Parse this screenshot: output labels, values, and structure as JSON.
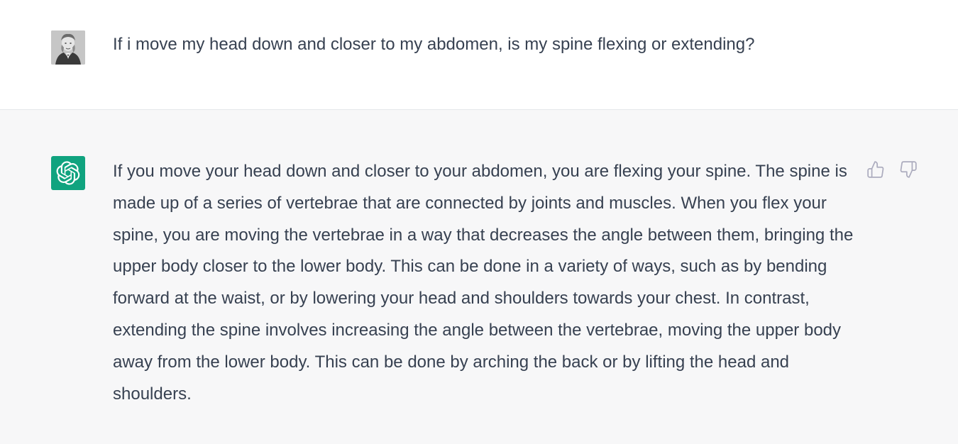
{
  "conversation": {
    "user_message": {
      "avatar_icon": "user-portrait-avatar",
      "text": "If i move my head down and closer to my abdomen, is my spine flexing or extending?"
    },
    "assistant_message": {
      "avatar_icon": "openai-logo-icon",
      "avatar_color": "#10a37f",
      "text": "If you move your head down and closer to your abdomen, you are flexing your spine. The spine is made up of a series of vertebrae that are connected by joints and muscles. When you flex your spine, you are moving the vertebrae in a way that decreases the angle between them, bringing the upper body closer to the lower body. This can be done in a variety of ways, such as by bending forward at the waist, or by lowering your head and shoulders towards your chest. In contrast, extending the spine involves increasing the angle between the vertebrae, moving the upper body away from the lower body. This can be done by arching the back or by lifting the head and shoulders.",
      "feedback": {
        "thumbs_up_icon": "thumbs-up-icon",
        "thumbs_down_icon": "thumbs-down-icon"
      }
    }
  },
  "colors": {
    "text": "#374151",
    "assistant_bg": "#f7f7f8",
    "user_bg": "#ffffff",
    "icon_gray": "#acacbe"
  }
}
